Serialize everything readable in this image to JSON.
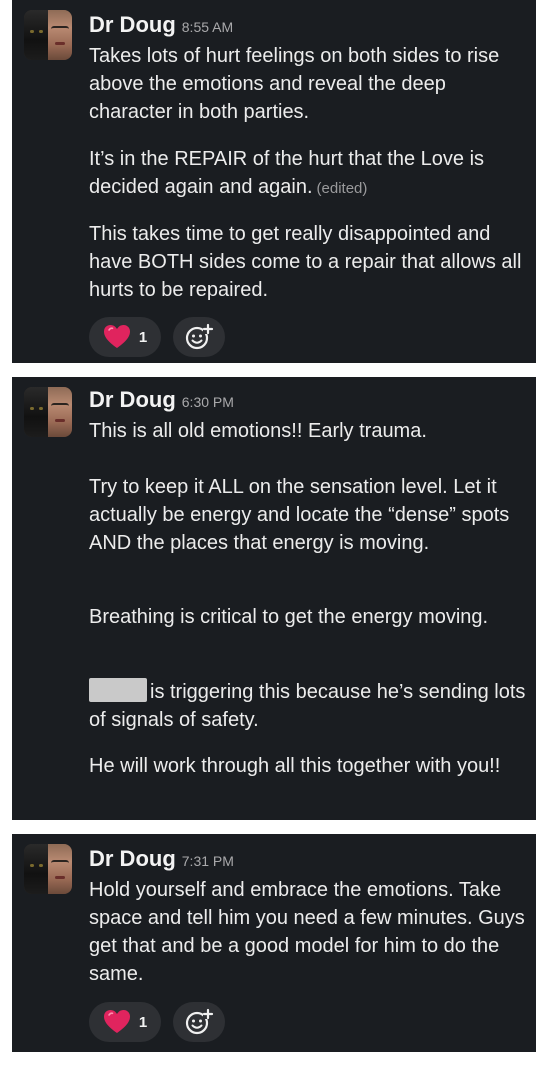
{
  "messages": [
    {
      "author": "Dr Doug",
      "time": "8:55 AM",
      "paragraphs": [
        "Takes lots of hurt feelings on both sides to rise above the emotions and reveal the deep character in both parties.",
        "It’s in the REPAIR of the hurt that the Love is decided again and again.",
        "This takes time to get really disappointed and have BOTH sides come to a repair that allows all hurts to be repaired."
      ],
      "edited_label": "(edited)",
      "reactions": [
        {
          "icon": "heart-icon",
          "count": "1"
        },
        {
          "icon": "add-reaction-icon"
        }
      ]
    },
    {
      "author": "Dr Doug",
      "time": "6:30 PM",
      "paragraphs": [
        "This is all old emotions!! Early trauma.",
        "Try to keep it ALL on the sensation level. Let it actually be energy and locate the “dense” spots AND the places that energy is moving.",
        "Breathing is critical to get the energy moving.",
        "is triggering this because he’s sending lots of signals of safety.",
        "He will work through all this together with you!!"
      ]
    },
    {
      "author": "Dr Doug",
      "time": "7:31 PM",
      "paragraphs": [
        "Hold yourself and embrace the emotions. Take space and tell him you need a few minutes. Guys get that and be a good model for him to do the same."
      ],
      "reactions": [
        {
          "icon": "heart-icon",
          "count": "1"
        },
        {
          "icon": "add-reaction-icon"
        }
      ]
    }
  ],
  "colors": {
    "card_background": "#1a1d21",
    "page_background": "#ffffff",
    "text": "#ececec",
    "muted_text": "#a9a9ab",
    "reaction_pill": "#2e3034",
    "heart": "#e0245e",
    "redaction": "#c9c9c9"
  }
}
